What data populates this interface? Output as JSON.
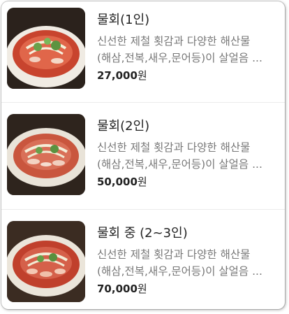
{
  "menu": {
    "items": [
      {
        "name": "물회(1인)",
        "desc_line1": "신선한 제철 횟감과 다양한 해산물",
        "desc_line2": "(해삼,전복,새우,문어등)이 살얼음 ...",
        "price": "27,000",
        "currency": "원",
        "image": "mulhoe-bowl-photo"
      },
      {
        "name": "물회(2인)",
        "desc_line1": "신선한 제철 횟감과 다양한 해산물",
        "desc_line2": "(해삼,전복,새우,문어등)이 살얼음 ...",
        "price": "50,000",
        "currency": "원",
        "image": "mulhoe-bowl-photo"
      },
      {
        "name": "물회 중 (2~3인)",
        "desc_line1": "신선한 제철 횟감과 다양한 해산물",
        "desc_line2": "(해삼,전복,새우,문어등)이 살얼음 ...",
        "price": "70,000",
        "currency": "원",
        "image": "mulhoe-bowl-photo"
      }
    ]
  },
  "colors": {
    "title": "#222222",
    "description": "#777777",
    "divider": "#ececec"
  }
}
